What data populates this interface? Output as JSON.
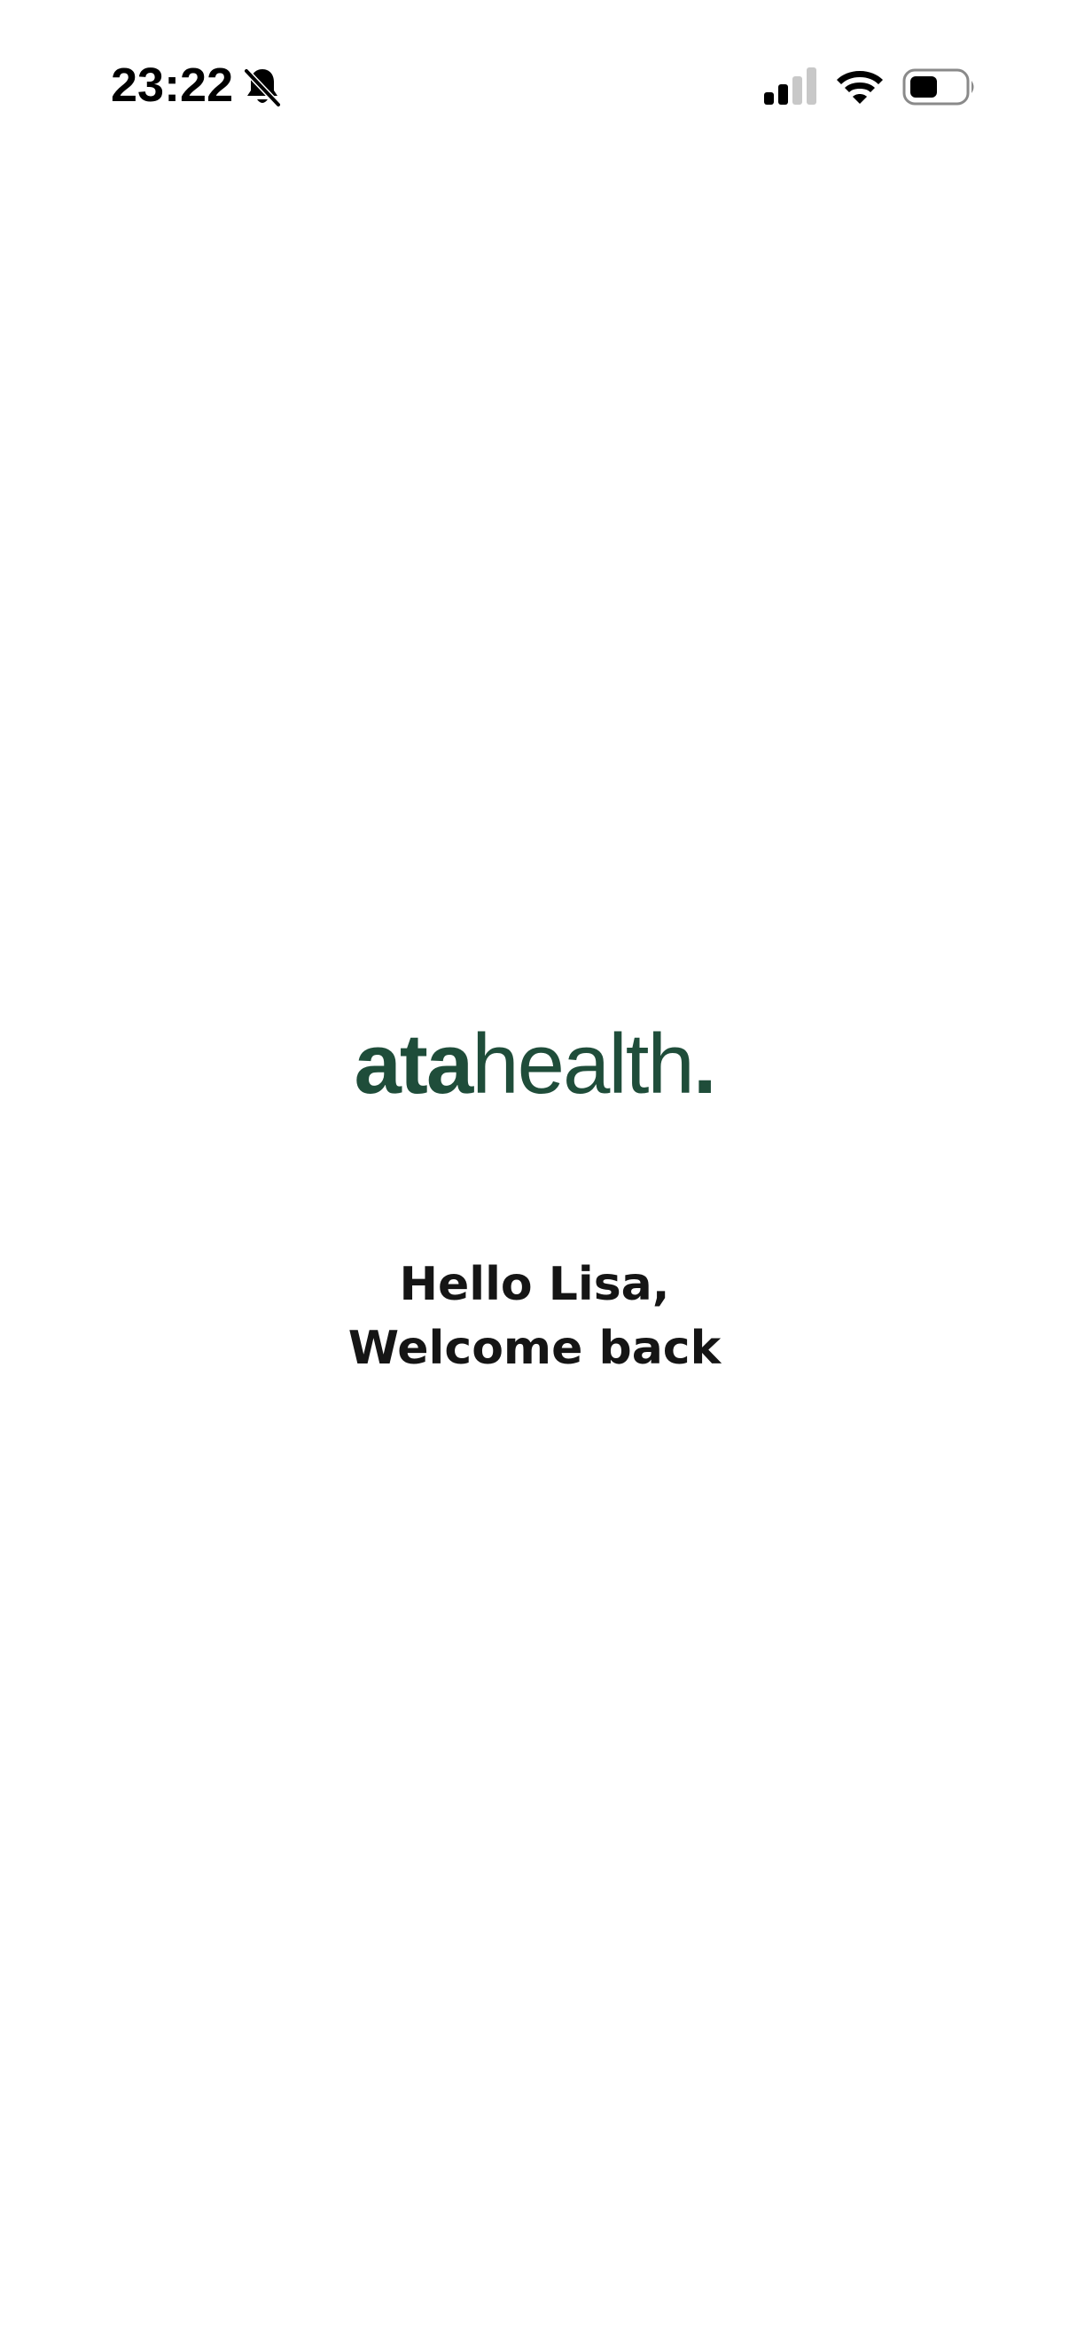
{
  "status_bar": {
    "time": "23:22",
    "icons": [
      "bell-slash-icon",
      "cellular-signal-icon",
      "wifi-icon",
      "battery-icon"
    ]
  },
  "logo": {
    "part_bold": "ata",
    "part_light": "health",
    "part_dot": ".",
    "color": "#1f4d3a"
  },
  "greeting": {
    "line1": "Hello Lisa,",
    "line2": "Welcome back"
  }
}
